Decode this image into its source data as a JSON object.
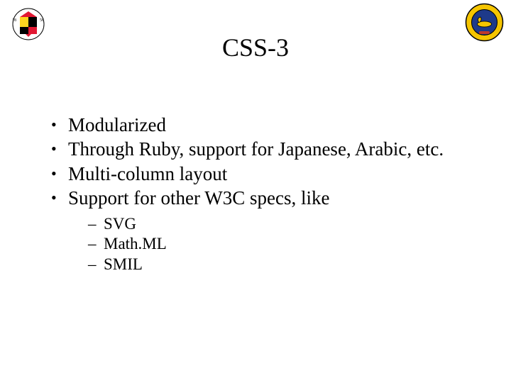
{
  "title": "CSS-3",
  "bullets": [
    {
      "text": "Modularized",
      "sub": []
    },
    {
      "text": "Through Ruby, support for Japanese, Arabic, etc.",
      "sub": []
    },
    {
      "text": "Multi-column layout",
      "sub": []
    },
    {
      "text": "Support for other W3C specs, like",
      "sub": [
        "SVG",
        "Math.ML",
        "SMIL"
      ]
    }
  ],
  "logos": {
    "left_name": "umd-seal",
    "right_name": "lamp-seal"
  }
}
